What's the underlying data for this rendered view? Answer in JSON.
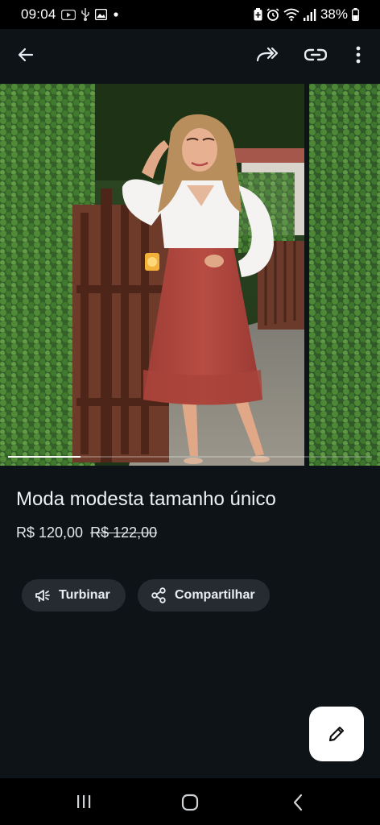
{
  "status_bar": {
    "time": "09:04",
    "battery": "38%",
    "icons": [
      "youtube-icon",
      "usb-icon",
      "gallery-icon",
      "dot-icon",
      "battery-saver-icon",
      "alarm-icon",
      "wifi-icon",
      "signal-icon",
      "battery-icon"
    ]
  },
  "app_bar": {
    "icons": [
      "back-arrow-icon",
      "share-forward-icon",
      "link-icon",
      "more-vert-icon"
    ]
  },
  "carousel": {
    "progress": 0.2,
    "images": [
      "woman-modest-outfit-photo",
      "hedge-photo"
    ]
  },
  "product": {
    "title": "Moda modesta tamanho único",
    "price": "R$ 120,00",
    "old_price": "R$ 122,00"
  },
  "actions": {
    "boost_label": "Turbinar",
    "share_label": "Compartilhar"
  },
  "fab": {
    "icon": "pencil-icon"
  },
  "nav_bar": {
    "icons": [
      "recents-icon",
      "home-icon",
      "back-icon"
    ]
  },
  "colors": {
    "background": "#0e1318",
    "chip": "#262b31",
    "fab": "#ffffff",
    "text": "#e9edf1"
  }
}
